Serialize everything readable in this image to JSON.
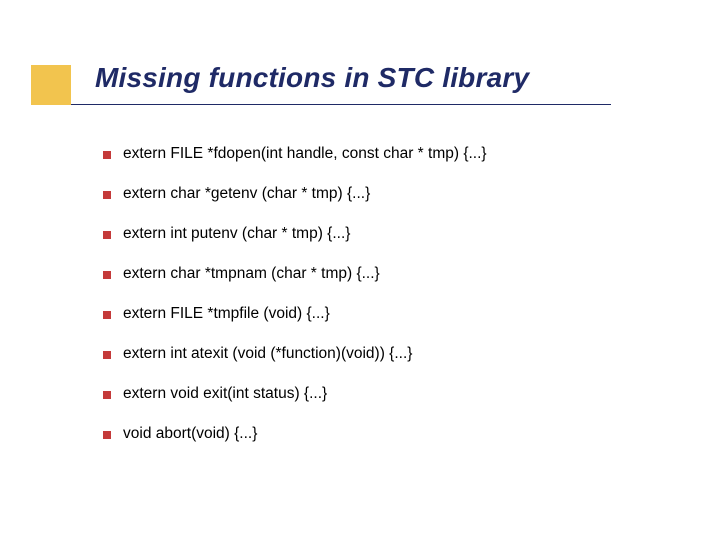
{
  "title": "Missing functions in STC library",
  "items": [
    "extern FILE *fdopen(int handle, const char * tmp) {...}",
    "extern char *getenv (char * tmp) {...}",
    "extern int putenv (char * tmp) {...}",
    "extern char *tmpnam (char * tmp) {...}",
    "extern FILE *tmpfile (void) {...}",
    "extern int atexit (void (*function)(void)) {...}",
    "extern void exit(int status) {...}",
    "void abort(void) {...}"
  ]
}
